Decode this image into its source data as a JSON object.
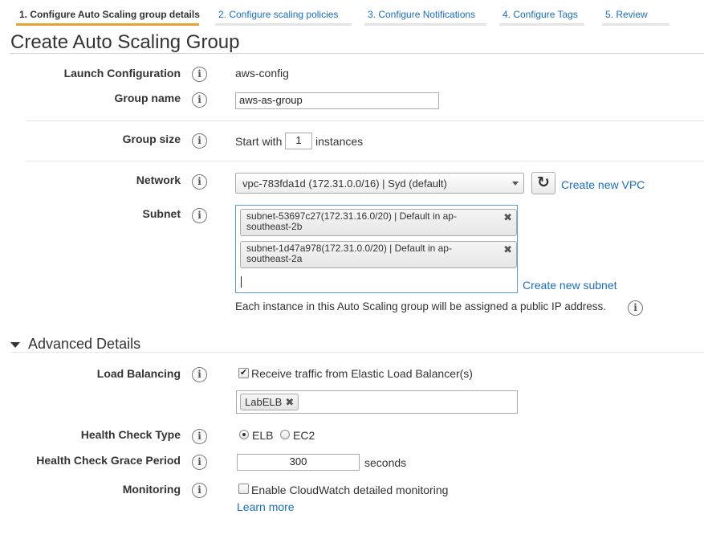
{
  "wizard_tabs": [
    "1. Configure Auto Scaling group details",
    "2. Configure scaling policies",
    "3. Configure Notifications",
    "4. Configure Tags",
    "5. Review"
  ],
  "page_title": "Create Auto Scaling Group",
  "info_glyph": "i",
  "form": {
    "launch_configuration": {
      "label": "Launch Configuration",
      "value": "aws-config"
    },
    "group_name": {
      "label": "Group name",
      "value": "aws-as-group"
    },
    "group_size": {
      "label": "Group size",
      "prefix": "Start with",
      "value": "1",
      "suffix": "instances"
    },
    "network": {
      "label": "Network",
      "selected": "vpc-783fda1d (172.31.0.0/16) | Syd (default)",
      "refresh_icon": "refresh-icon",
      "create_link": "Create new VPC"
    },
    "subnet": {
      "label": "Subnet",
      "tokens": [
        {
          "line1": "subnet-53697c27(172.31.16.0/20) | Default in ap-",
          "line2": "southeast-2b"
        },
        {
          "line1": "subnet-1d47a978(172.31.0.0/20) | Default in ap-",
          "line2": "southeast-2a"
        }
      ],
      "remove_glyph": "✖",
      "create_link": "Create new subnet",
      "note": "Each instance in this Auto Scaling group will be assigned a public IP address."
    }
  },
  "advanced": {
    "title": "Advanced Details",
    "load_balancing": {
      "label": "Load Balancing",
      "checkbox_label": "Receive traffic from Elastic Load Balancer(s)",
      "checked": true,
      "check_glyph": "✔",
      "chip": "LabELB",
      "chip_remove": "✖"
    },
    "health_check_type": {
      "label": "Health Check Type",
      "options": [
        "ELB",
        "EC2"
      ],
      "selected": "ELB"
    },
    "grace_period": {
      "label": "Health Check Grace Period",
      "value": "300",
      "suffix": "seconds"
    },
    "monitoring": {
      "label": "Monitoring",
      "checkbox_label": "Enable CloudWatch detailed monitoring",
      "checked": false,
      "link": "Learn more"
    }
  },
  "colors": {
    "accent_tab": "#e8a233",
    "link": "#1a6dc2",
    "focus_border": "#5b9dd9"
  }
}
